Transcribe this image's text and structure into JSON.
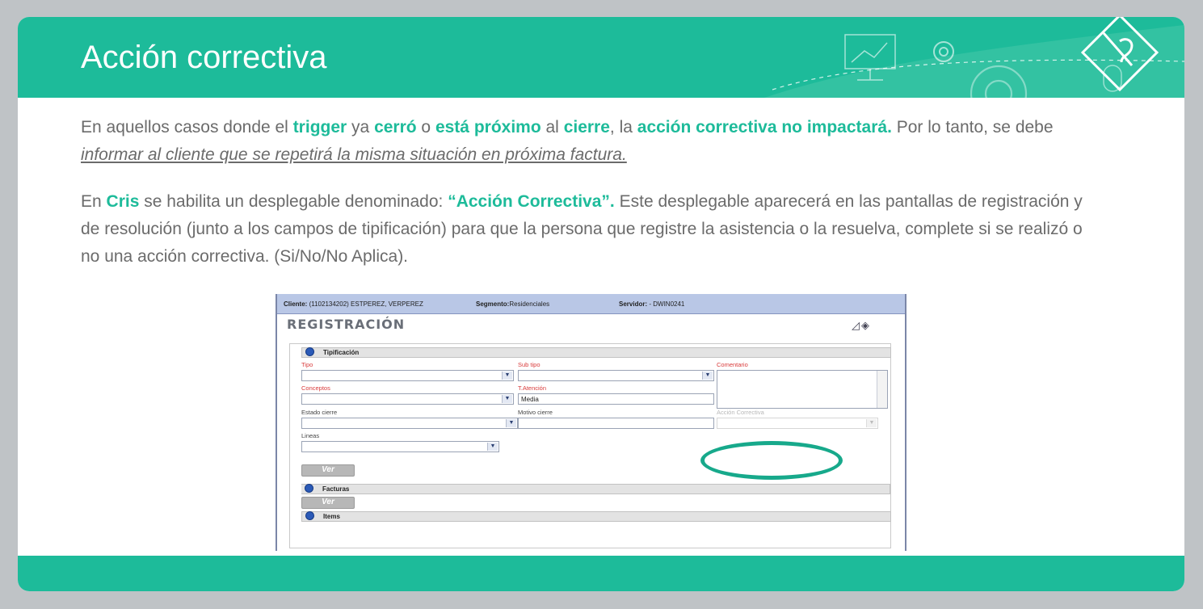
{
  "slide": {
    "title": "Acción correctiva",
    "paragraph1": [
      {
        "text": "En aquellos casos donde el ",
        "style": "normal"
      },
      {
        "text": "trigger",
        "style": "highlight"
      },
      {
        "text": " ya ",
        "style": "normal"
      },
      {
        "text": "cerró",
        "style": "highlight"
      },
      {
        "text": " o ",
        "style": "normal"
      },
      {
        "text": "está próximo",
        "style": "highlight"
      },
      {
        "text": " al ",
        "style": "normal"
      },
      {
        "text": "cierre",
        "style": "highlight"
      },
      {
        "text": ", la ",
        "style": "normal"
      },
      {
        "text": "acción correctiva no impactará.",
        "style": "highlight"
      },
      {
        "text": " Por lo tanto, se debe ",
        "style": "normal"
      },
      {
        "text": "informar al cliente que se repetirá la misma situación en próxima factura.",
        "style": "underline"
      }
    ],
    "paragraph2": [
      {
        "text": "En ",
        "style": "normal"
      },
      {
        "text": "Cris",
        "style": "highlight"
      },
      {
        "text": " se habilita un desplegable denominado: ",
        "style": "normal"
      },
      {
        "text": "“Acción Correctiva”.",
        "style": "highlight"
      },
      {
        "text": " Este desplegable aparecerá en las pantallas de registración y de resolución (junto a los campos de tipificación) para que la persona que registre la asistencia o la resuelva, complete si se realizó o no una acción correctiva. (Si/No/No Aplica).",
        "style": "normal"
      }
    ],
    "colors": {
      "accent": "#1dbb9a",
      "text": "#6b6b6b",
      "background": "#bfc3c6"
    },
    "header_icons": [
      "presentation-screen-icon",
      "gear-icon",
      "gear-large-icon",
      "mouse-icon",
      "pencil-puzzle-diamond-icon"
    ]
  },
  "screenshot": {
    "header": {
      "cliente_label": "Cliente:",
      "cliente_value": "(1102134202) ESTPEREZ, VERPEREZ",
      "segmento_label": "Segmento:",
      "segmento_value": "Residenciales",
      "servidor_label": "Servidor:",
      "servidor_value": "- DWIN0241"
    },
    "page_title": "REGISTRACIÓN",
    "sections": {
      "tipificacion": "Tipificación",
      "facturas": "Facturas",
      "items": "Items"
    },
    "fields": {
      "tipo": {
        "label": "Tipo",
        "value": ""
      },
      "sub_tipo": {
        "label": "Sub tipo",
        "value": ""
      },
      "comentario": {
        "label": "Comentario",
        "value": ""
      },
      "conceptos": {
        "label": "Conceptos",
        "value": ""
      },
      "t_atencion": {
        "label": "T.Atención",
        "value": "Media"
      },
      "estado_cierre": {
        "label": "Estado cierre",
        "value": ""
      },
      "motivo_cierre": {
        "label": "Motivo cierre",
        "value": ""
      },
      "accion_correctiva": {
        "label": "Acción Correctiva",
        "value": ""
      },
      "lineas": {
        "label": "Lineas",
        "value": ""
      }
    },
    "buttons": {
      "ver": "Ver"
    },
    "highlight_color": "#17a98b"
  }
}
